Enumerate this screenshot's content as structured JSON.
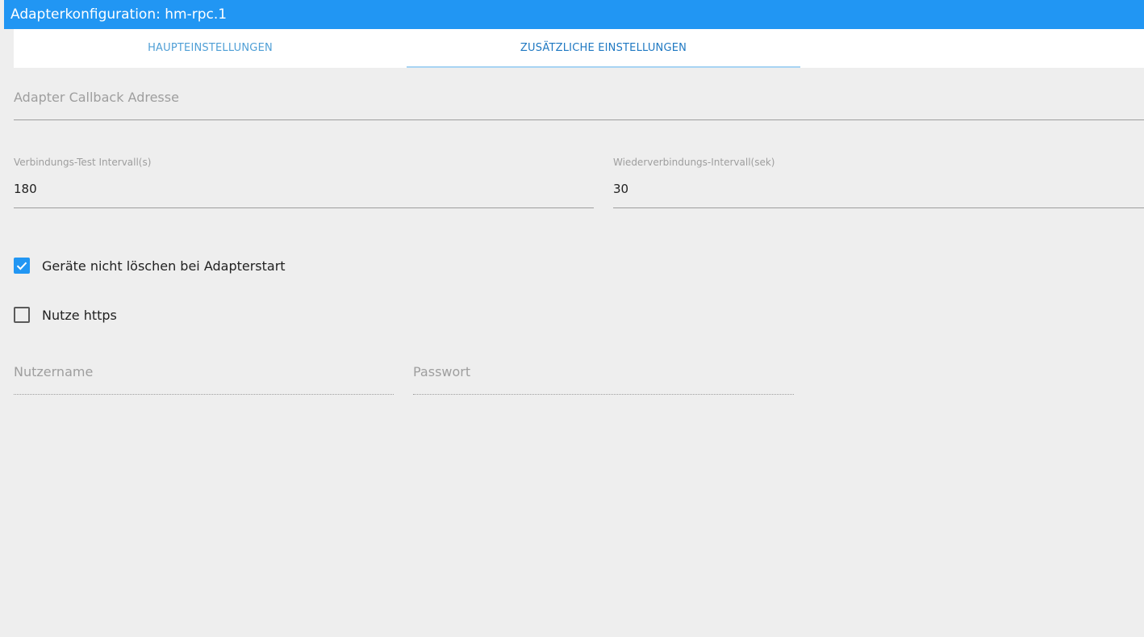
{
  "window": {
    "title": "Adapterkonfiguration: hm-rpc.1"
  },
  "tabs": [
    {
      "label": "HAUPTEINSTELLUNGEN",
      "active": false
    },
    {
      "label": "ZUSÄTZLICHE EINSTELLUNGEN",
      "active": true
    }
  ],
  "fields": {
    "callback_address": {
      "placeholder": "Adapter Callback Adresse",
      "value": ""
    },
    "connection_test_interval": {
      "label": "Verbindungs-Test Intervall(s)",
      "value": "180"
    },
    "reconnect_interval": {
      "label": "Wiederverbindungs-Intervall(sek)",
      "value": "30"
    },
    "username": {
      "placeholder": "Nutzername",
      "value": ""
    },
    "password": {
      "placeholder": "Passwort",
      "value": ""
    }
  },
  "checkboxes": {
    "dont_delete_devices": {
      "label": "Geräte nicht löschen bei Adapterstart",
      "checked": true
    },
    "use_https": {
      "label": "Nutze https",
      "checked": false
    }
  },
  "colors": {
    "accent": "#2196f3",
    "background": "#eeeeee",
    "tab_active_text": "#1e78c2",
    "tab_inactive_text": "#4f9fd6"
  },
  "icons": {
    "checkmark": "check-icon"
  }
}
